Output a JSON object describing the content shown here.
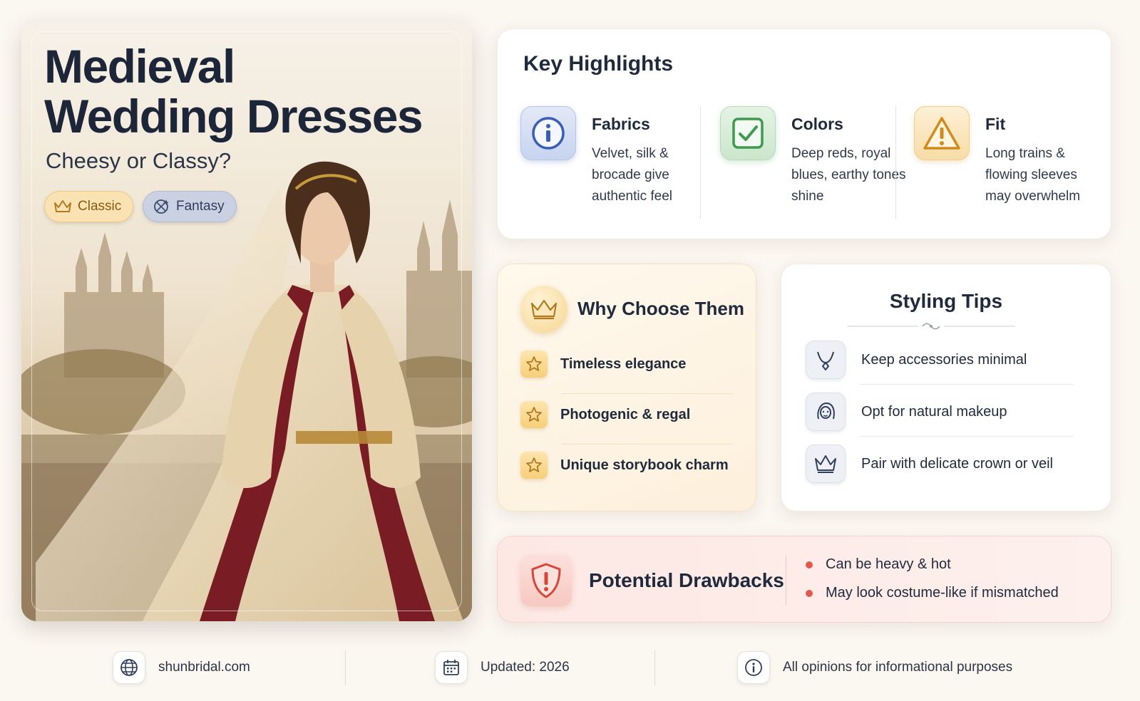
{
  "hero": {
    "title_line1": "Medieval",
    "title_line2": "Wedding Dresses",
    "subtitle": "Cheesy or Classy?",
    "tags": [
      {
        "label": "Classic",
        "icon": "crown-icon"
      },
      {
        "label": "Fantasy",
        "icon": "sparkle-icon"
      }
    ]
  },
  "highlights": {
    "title": "Key Highlights",
    "items": [
      {
        "name": "Fabrics",
        "description": "Velvet, silk & brocade give authentic feel",
        "icon": "info-icon",
        "color": "#3a5fb5"
      },
      {
        "name": "Colors",
        "description": "Deep reds, royal blues, earthy tones shine",
        "icon": "check-icon",
        "color": "#3f9a4e"
      },
      {
        "name": "Fit",
        "description": "Long trains & flowing sleeves may overwhelm",
        "icon": "warning-icon",
        "color": "#d18b1c"
      }
    ]
  },
  "why": {
    "title": "Why Choose Them",
    "items": [
      "Timeless elegance",
      "Photogenic & regal",
      "Unique storybook charm"
    ]
  },
  "tips": {
    "title": "Styling Tips",
    "items": [
      {
        "label": "Keep accessories minimal",
        "icon": "necklace-icon"
      },
      {
        "label": "Opt for natural makeup",
        "icon": "face-icon"
      },
      {
        "label": "Pair with delicate crown or veil",
        "icon": "crown-icon"
      }
    ]
  },
  "drawbacks": {
    "title": "Potential Drawbacks",
    "items": [
      "Can be heavy & hot",
      "May look costume-like if mismatched"
    ],
    "accent": "#e2584a"
  },
  "footer": {
    "site": "shunbridal.com",
    "updated": "Updated: 2026",
    "note": "All opinions for informational purposes"
  }
}
